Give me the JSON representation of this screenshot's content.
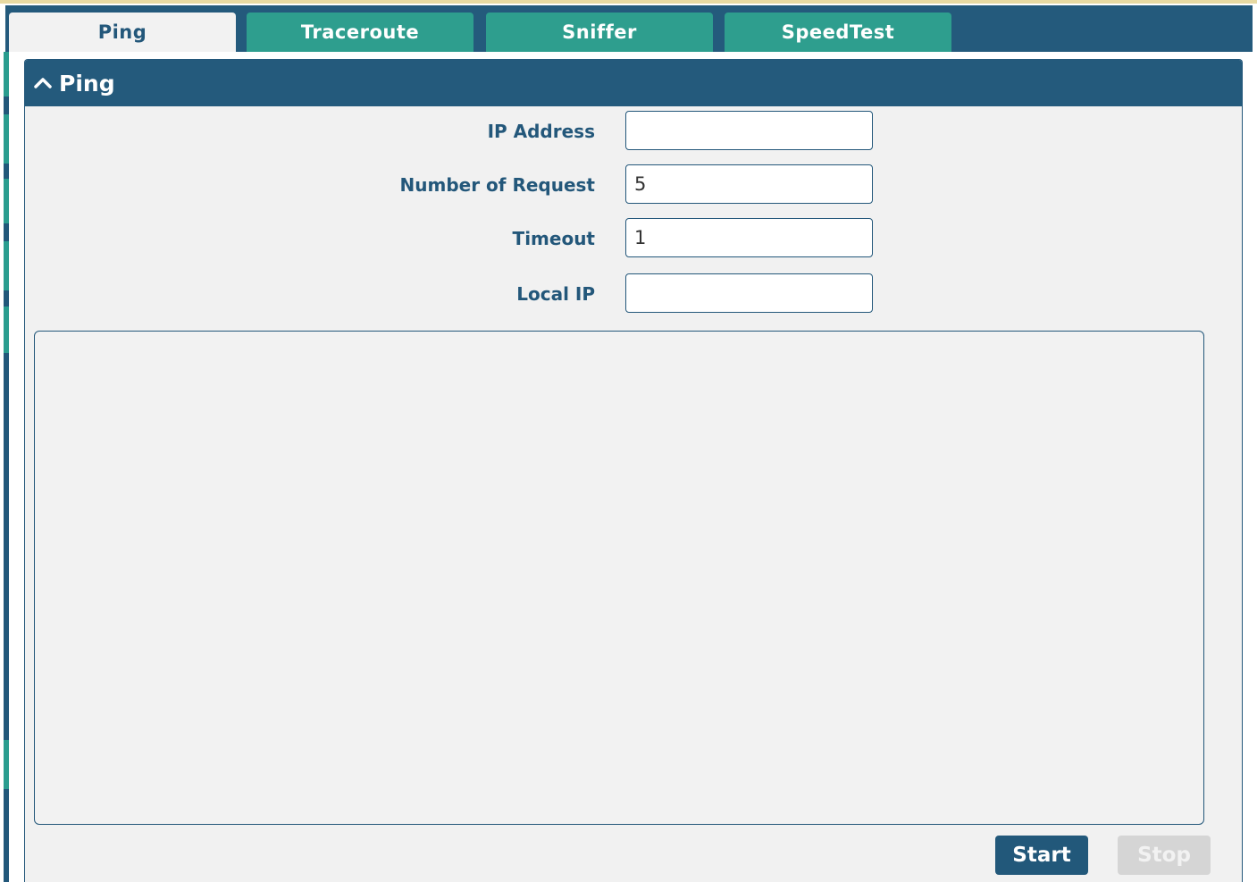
{
  "tabs": [
    {
      "label": "Ping",
      "active": true
    },
    {
      "label": "Traceroute",
      "active": false
    },
    {
      "label": "Sniffer",
      "active": false
    },
    {
      "label": "SpeedTest",
      "active": false
    }
  ],
  "panel": {
    "title": "Ping",
    "toggle_icon": "chevron-up-icon"
  },
  "form": {
    "ip_address": {
      "label": "IP Address",
      "value": ""
    },
    "number_of_request": {
      "label": "Number of Request",
      "value": "5"
    },
    "timeout": {
      "label": "Timeout",
      "value": "1"
    },
    "local_ip": {
      "label": "Local IP",
      "value": ""
    }
  },
  "output": {
    "text": ""
  },
  "buttons": {
    "start_label": "Start",
    "stop_label": "Stop",
    "stop_enabled": false
  },
  "colors": {
    "primary": "#245a7c",
    "tab": "#2e9e8e",
    "panel_bg": "#f1f1f1",
    "disabled": "#d5d5d5"
  }
}
